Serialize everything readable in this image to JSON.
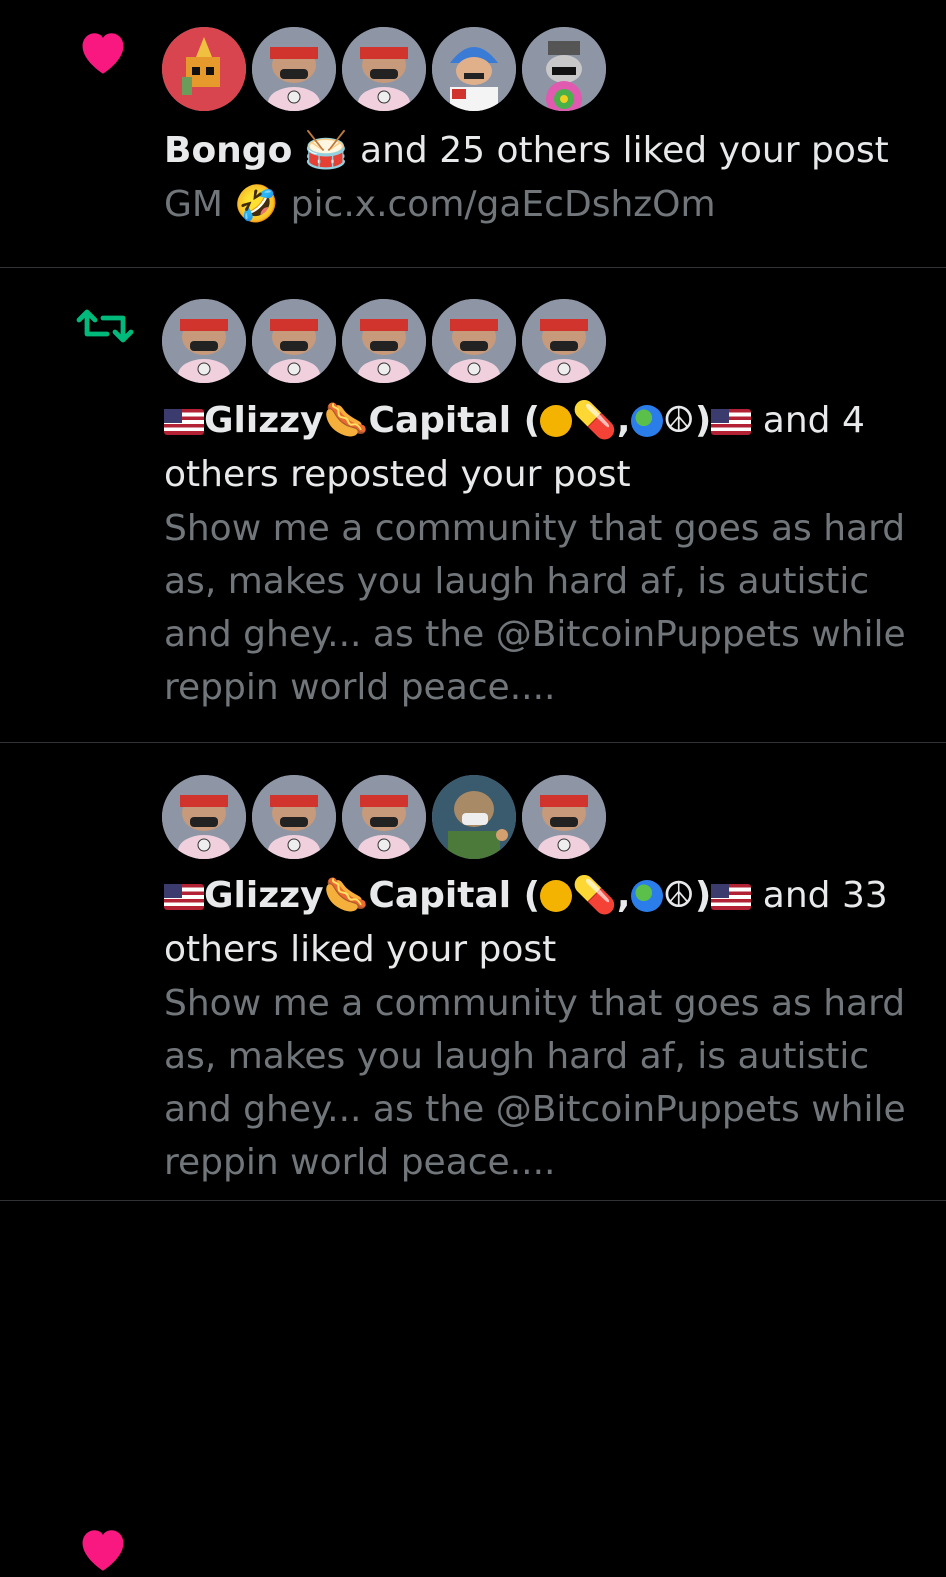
{
  "notifications": [
    {
      "type": "like",
      "type_icon": "heart-icon",
      "type_color": "#f91880",
      "actor": "Bongo",
      "actor_emoji": "🥁",
      "action": " and 25 others liked your post",
      "preview_text": "GM 🤣 pic.x.com/gaEcDshzOm"
    },
    {
      "type": "repost",
      "type_icon": "repost-icon",
      "type_color": "#00ba7c",
      "actor": "Glizzy",
      "actor_emoji": "🌭",
      "actor_suffix": "Capital (",
      "actor_suffix2": ",",
      "actor_suffix3": ")",
      "action": " and 4 others reposted your post",
      "preview_text": "Show me a community that goes as hard as, makes you laugh hard af, is autistic and ghey... as the @BitcoinPuppets while reppin world peace...."
    },
    {
      "type": "like",
      "type_icon": "heart-icon",
      "type_color": "#f91880",
      "actor": "Glizzy",
      "actor_emoji": "🌭",
      "actor_suffix": "Capital (",
      "actor_suffix2": ",",
      "actor_suffix3": ")",
      "action": " and 33 others liked your post",
      "preview_text": "Show me a community that goes as hard as, makes you laugh hard af, is autistic and ghey... as the @BitcoinPuppets while reppin world peace...."
    }
  ]
}
